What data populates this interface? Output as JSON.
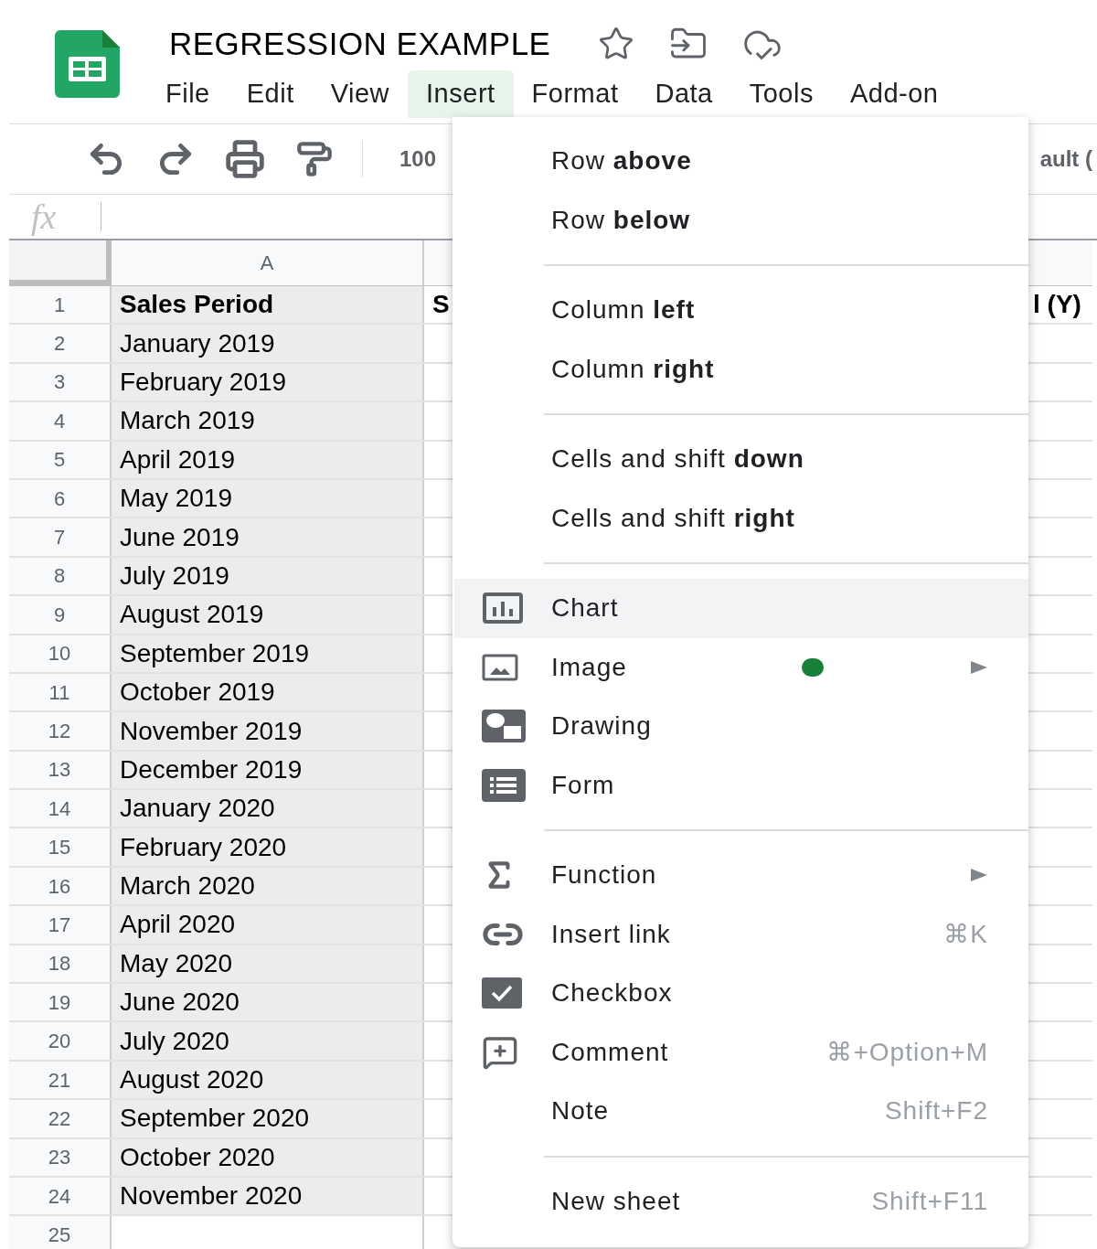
{
  "document": {
    "title": "REGRESSION EXAMPLE"
  },
  "menu_bar": [
    {
      "label": "File",
      "selected": false
    },
    {
      "label": "Edit",
      "selected": false
    },
    {
      "label": "View",
      "selected": false
    },
    {
      "label": "Insert",
      "selected": true
    },
    {
      "label": "Format",
      "selected": false
    },
    {
      "label": "Data",
      "selected": false
    },
    {
      "label": "Tools",
      "selected": false
    },
    {
      "label": "Add-on",
      "selected": false
    }
  ],
  "toolbar": {
    "zoom": "100",
    "font": "ault ("
  },
  "formula_bar": {
    "label": "fx"
  },
  "sheet": {
    "columns": [
      "A"
    ],
    "rows": [
      {
        "number": "1",
        "a": "Sales Period",
        "b": "S",
        "c": "l (Y)",
        "header": true,
        "selected": true
      },
      {
        "number": "2",
        "a": "January 2019",
        "header": false,
        "selected": true
      },
      {
        "number": "3",
        "a": "February 2019",
        "header": false,
        "selected": true
      },
      {
        "number": "4",
        "a": "March 2019",
        "header": false,
        "selected": true
      },
      {
        "number": "5",
        "a": "April 2019",
        "header": false,
        "selected": true
      },
      {
        "number": "6",
        "a": "May 2019",
        "header": false,
        "selected": true
      },
      {
        "number": "7",
        "a": "June 2019",
        "header": false,
        "selected": true
      },
      {
        "number": "8",
        "a": "July 2019",
        "header": false,
        "selected": true
      },
      {
        "number": "9",
        "a": "August 2019",
        "header": false,
        "selected": true
      },
      {
        "number": "10",
        "a": "September 2019",
        "header": false,
        "selected": true
      },
      {
        "number": "11",
        "a": "October 2019",
        "header": false,
        "selected": true
      },
      {
        "number": "12",
        "a": "November 2019",
        "header": false,
        "selected": true
      },
      {
        "number": "13",
        "a": "December 2019",
        "header": false,
        "selected": true
      },
      {
        "number": "14",
        "a": "January 2020",
        "header": false,
        "selected": true
      },
      {
        "number": "15",
        "a": "February 2020",
        "header": false,
        "selected": true
      },
      {
        "number": "16",
        "a": "March 2020",
        "header": false,
        "selected": true
      },
      {
        "number": "17",
        "a": "April 2020",
        "header": false,
        "selected": true
      },
      {
        "number": "18",
        "a": "May 2020",
        "header": false,
        "selected": true
      },
      {
        "number": "19",
        "a": "June 2020",
        "header": false,
        "selected": true
      },
      {
        "number": "20",
        "a": "July 2020",
        "header": false,
        "selected": true
      },
      {
        "number": "21",
        "a": "August 2020",
        "header": false,
        "selected": true
      },
      {
        "number": "22",
        "a": "September 2020",
        "header": false,
        "selected": true
      },
      {
        "number": "23",
        "a": "October 2020",
        "header": false,
        "selected": true
      },
      {
        "number": "24",
        "a": "November 2020",
        "header": false,
        "selected": true
      },
      {
        "number": "25",
        "selected": false
      }
    ]
  },
  "insert_menu": {
    "groups": [
      {
        "items": [
          {
            "label": "Row **above**",
            "selected": false
          },
          {
            "label": "Row **below**",
            "selected": false
          }
        ]
      },
      {
        "items": [
          {
            "label": "Column **left**",
            "selected": false
          },
          {
            "label": "Column **right**",
            "selected": false
          }
        ]
      },
      {
        "items": [
          {
            "label": "Cells and shift **down**",
            "selected": false
          },
          {
            "label": "Cells and shift **right**",
            "selected": false
          }
        ]
      },
      {
        "items": [
          {
            "label": "Chart",
            "selected": true
          },
          {
            "label": "Image",
            "selected": false,
            "submenu": true,
            "new_dot": true
          },
          {
            "label": "Drawing",
            "selected": false
          },
          {
            "label": "Form",
            "selected": false
          }
        ]
      },
      {
        "items": [
          {
            "label": "Function",
            "selected": false,
            "submenu": true
          },
          {
            "label": "Insert link",
            "selected": false,
            "shortcut": "⌘K"
          },
          {
            "label": "Checkbox",
            "selected": false
          },
          {
            "label": "Comment",
            "selected": false,
            "shortcut": "⌘+Option+M"
          },
          {
            "label": "Note",
            "selected": false,
            "shortcut": "Shift+F2"
          }
        ]
      },
      {
        "items": [
          {
            "label": "New sheet",
            "selected": false,
            "shortcut": "Shift+F11"
          }
        ]
      }
    ]
  }
}
